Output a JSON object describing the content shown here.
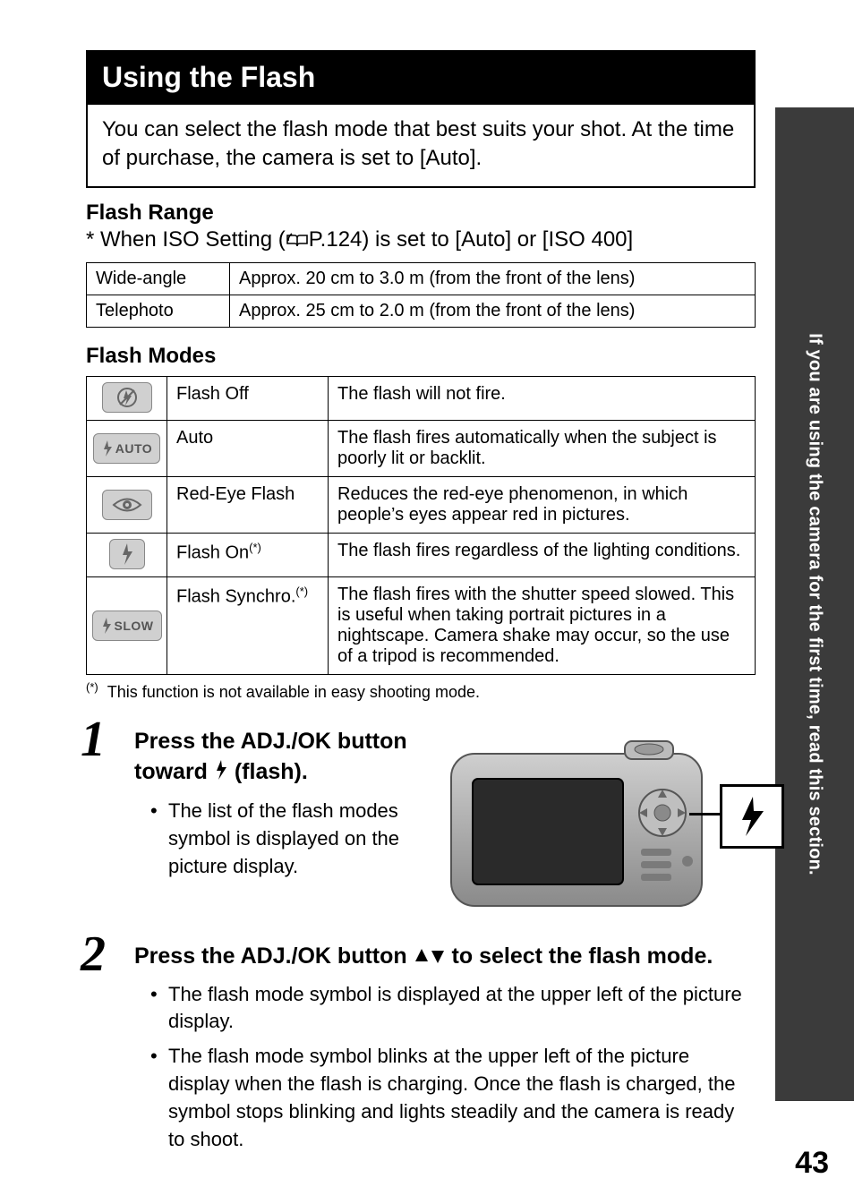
{
  "side_tab": "If you are using the camera for the first time, read this section.",
  "title": "Using the Flash",
  "intro": "You can select the flash mode that best suits your shot. At the time of purchase, the camera is set to [Auto].",
  "flash_range": {
    "heading": "Flash Range",
    "iso_note_prefix": "*  When ISO Setting (",
    "iso_page_ref": "P.124",
    "iso_note_suffix": ") is set to [Auto] or [ISO 400]",
    "rows": [
      {
        "label": "Wide-angle",
        "value": "Approx. 20 cm to 3.0 m (from the front of the lens)"
      },
      {
        "label": "Telephoto",
        "value": "Approx. 25 cm to 2.0 m (from the front of the lens)"
      }
    ]
  },
  "flash_modes": {
    "heading": "Flash Modes",
    "rows": [
      {
        "icon": "flash-off",
        "icon_text": "",
        "name": "Flash Off",
        "name_sup": "",
        "desc": "The flash will not fire."
      },
      {
        "icon": "flash-auto",
        "icon_text": "AUTO",
        "name": "Auto",
        "name_sup": "",
        "desc": "The flash fires automatically when the subject is poorly lit or backlit."
      },
      {
        "icon": "red-eye",
        "icon_text": "",
        "name": "Red-Eye Flash",
        "name_sup": "",
        "desc": "Reduces the red-eye phenomenon, in which people’s eyes appear red in pictures."
      },
      {
        "icon": "flash-on",
        "icon_text": "",
        "name": "Flash On",
        "name_sup": "(*)",
        "desc": "The flash fires regardless of the lighting conditions."
      },
      {
        "icon": "flash-slow",
        "icon_text": "SLOW",
        "name": "Flash Synchro.",
        "name_sup": "(*)",
        "desc": "The flash fires with the shutter speed slowed. This is useful when taking portrait pictures in a nightscape. Camera shake may occur, so the use of a tripod is recommended."
      }
    ],
    "footnote_mark": "(*)",
    "footnote": "This function is not available in easy shooting mode."
  },
  "steps": [
    {
      "num": "1",
      "head_before": "Press the ADJ./OK button toward ",
      "head_after": " (flash).",
      "bullets": [
        "The list of the flash modes symbol is displayed on the picture display."
      ]
    },
    {
      "num": "2",
      "head_before": "Press the ADJ./OK button ",
      "head_after": " to select the flash mode.",
      "bullets": [
        "The flash mode symbol is displayed at the upper left of the picture display.",
        "The flash mode symbol blinks at the upper left of the picture display when the flash is charging. Once the flash is charged, the symbol stops blinking and lights steadily and the camera is ready to shoot."
      ]
    }
  ],
  "page_number": "43"
}
